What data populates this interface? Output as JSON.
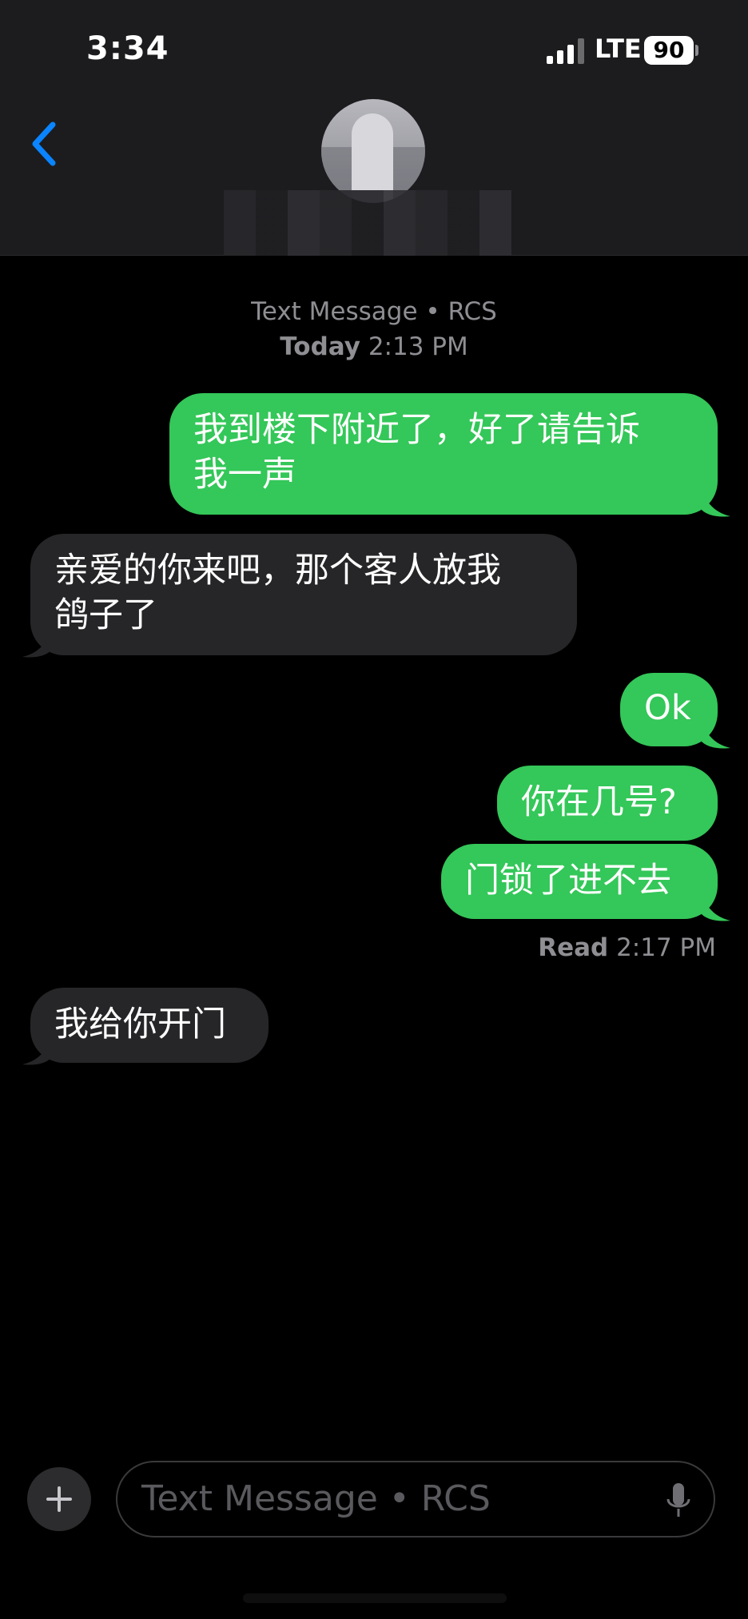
{
  "status_bar": {
    "time": "3:34",
    "network": "LTE",
    "battery": "90"
  },
  "meta": {
    "service": "Text Message • RCS",
    "day": "Today",
    "start_time": "2:13 PM"
  },
  "messages": [
    {
      "side": "sent",
      "text": "我到楼下附近了，好了请告诉\n我一声"
    },
    {
      "side": "received",
      "text": "亲爱的你来吧，那个客人放我\n鸽子了"
    },
    {
      "side": "sent",
      "text": "Ok"
    },
    {
      "side": "sent",
      "text": "你在几号?"
    },
    {
      "side": "sent",
      "text": "门锁了进不去"
    },
    {
      "side": "received",
      "text": "我给你开门"
    }
  ],
  "read_receipt": {
    "label": "Read",
    "time": "2:17 PM"
  },
  "composer": {
    "placeholder": "Text Message • RCS"
  },
  "colors": {
    "sent_bubble": "#34c759",
    "received_bubble": "#262628",
    "accent": "#0a84ff"
  }
}
